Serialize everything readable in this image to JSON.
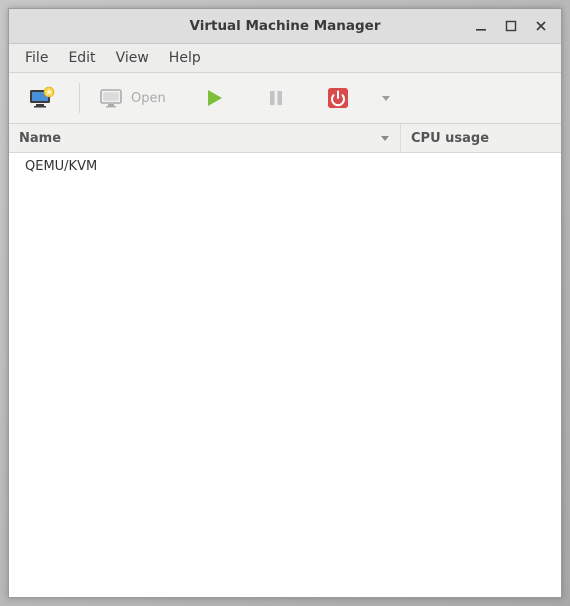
{
  "window": {
    "title": "Virtual Machine Manager"
  },
  "menubar": {
    "file": "File",
    "edit": "Edit",
    "view": "View",
    "help": "Help"
  },
  "toolbar": {
    "open_label": "Open"
  },
  "columns": {
    "name": "Name",
    "cpu": "CPU usage"
  },
  "rows": [
    {
      "name": "QEMU/KVM"
    }
  ]
}
